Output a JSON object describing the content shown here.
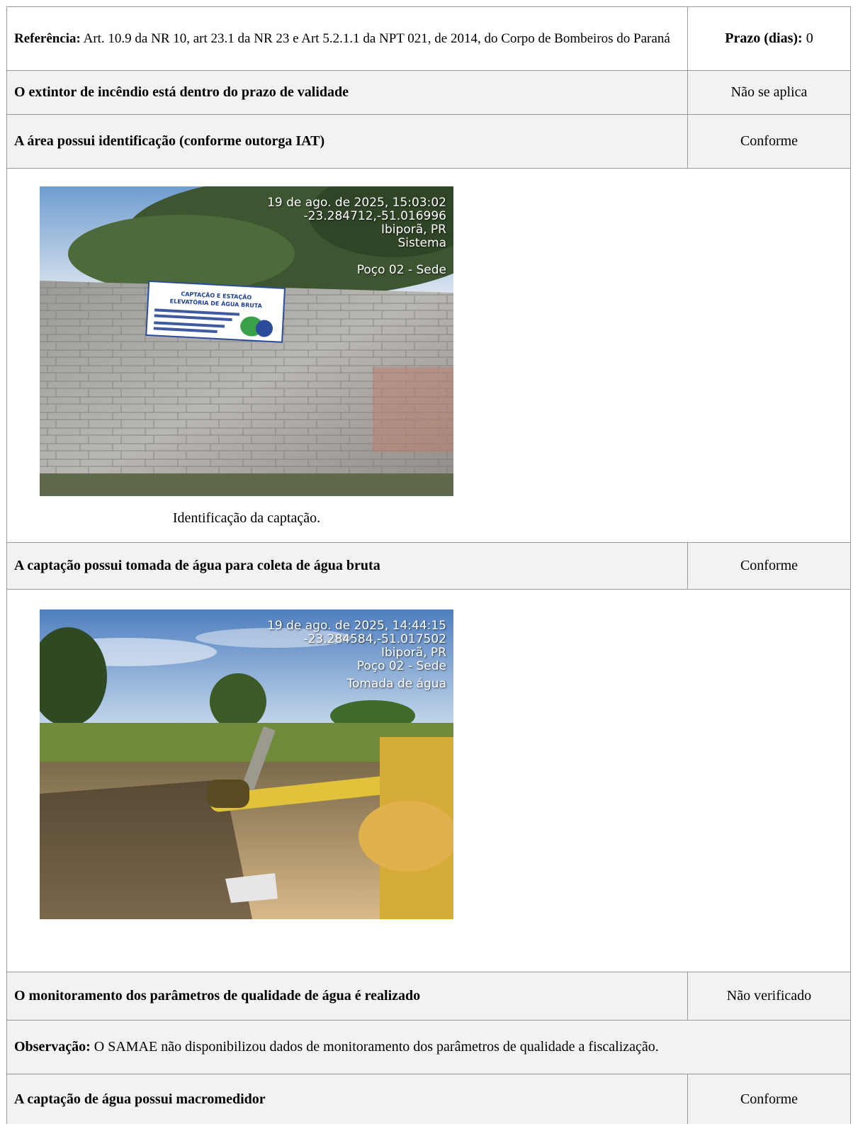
{
  "reference_row": {
    "label": "Referência:",
    "text": "Art. 10.9 da NR 10, art 23.1 da NR 23 e Art 5.2.1.1 da NPT 021, de 2014, do Corpo de Bombeiros do Paraná",
    "deadline_label": "Prazo (dias):",
    "deadline_value": "0"
  },
  "items": [
    {
      "question": "O extintor de incêndio está dentro do prazo de validade",
      "status": "Não se aplica"
    },
    {
      "question": "A área possui identificação (conforme outorga IAT)",
      "status": "Conforme"
    },
    {
      "question": "A captação possui tomada de água para coleta de água bruta",
      "status": "Conforme"
    },
    {
      "question": "O monitoramento dos parâmetros de qualidade de água é realizado",
      "status": "Não verificado"
    },
    {
      "question": "A captação de água possui macromedidor",
      "status": "Conforme"
    }
  ],
  "photo1": {
    "stamp": [
      "19 de ago. de 2025, 15:03:02",
      "-23.284712,-51.016996",
      "Ibiporã, PR",
      "Sistema",
      "",
      "Poço 02 - Sede"
    ],
    "sign_title": "CAPTAÇÃO E ESTAÇÃO ELEVATÓRIA DE ÁGUA BRUTA",
    "caption": "Identificação da captação."
  },
  "photo2": {
    "stamp": [
      "19 de ago. de 2025, 14:44:15",
      "-23.284584,-51.017502",
      "Ibiporã, PR",
      "Poço 02 - Sede",
      "Tomada de água"
    ]
  },
  "observation": {
    "label": "Observação:",
    "text": "O SAMAE não disponibilizou dados de monitoramento dos parâmetros de qualidade a fiscalização."
  }
}
